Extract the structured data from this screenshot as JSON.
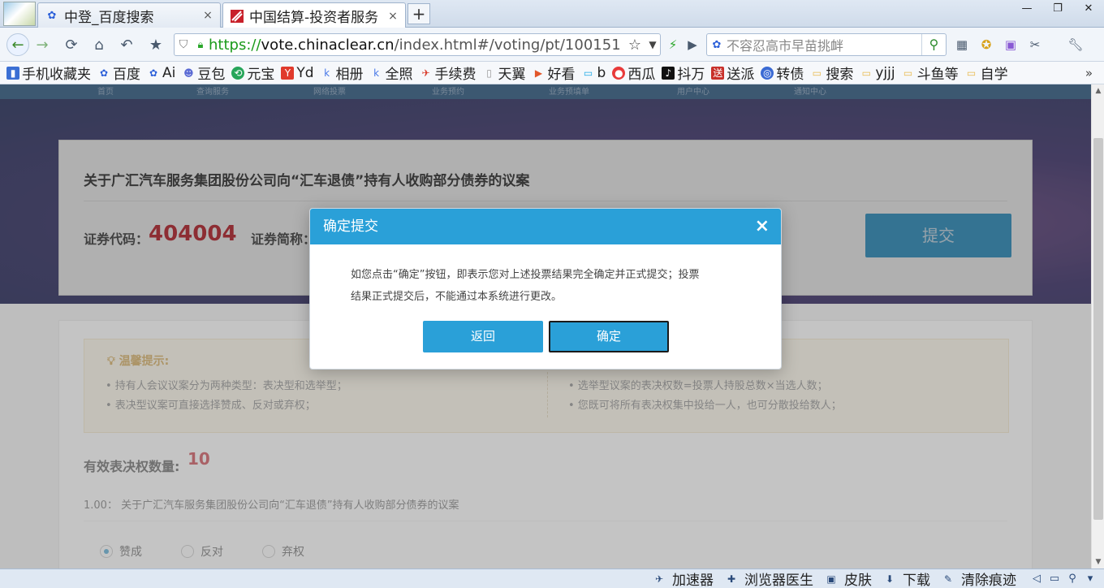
{
  "browser": {
    "tabs": [
      {
        "title": "中登_百度搜索",
        "close": "×"
      },
      {
        "title": "中国结算-投资者服务",
        "close": "×"
      }
    ],
    "new_tab": "+",
    "window": {
      "minimize": "—",
      "restore": "❐",
      "close": "✕"
    },
    "url": {
      "scheme": "https://",
      "host": "vote.chinaclear.cn",
      "path": "/index.html#/voting/pt/100151"
    },
    "search_placeholder": "不容忍高市早苗挑衅",
    "bookmarks": [
      {
        "label": "手机收藏夹",
        "icon": "phone-icon",
        "color": "#3b6fd4"
      },
      {
        "label": "百度",
        "icon": "baidu-paw-icon",
        "color": "#2b5fd9"
      },
      {
        "label": "Ai",
        "icon": "baidu-paw-icon",
        "color": "#2b5fd9"
      },
      {
        "label": "豆包",
        "icon": "doubao-icon",
        "color": "#5a6ad4"
      },
      {
        "label": "元宝",
        "icon": "yuanbao-icon",
        "color": "#27a55a"
      },
      {
        "label": "Yd",
        "icon": "youdao-icon",
        "color": "#e03a2c"
      },
      {
        "label": "相册",
        "icon": "album-icon",
        "color": "#4a7ae8"
      },
      {
        "label": "全照",
        "icon": "album-icon",
        "color": "#4a7ae8"
      },
      {
        "label": "手续费",
        "icon": "plane-icon",
        "color": "#d83a2a"
      },
      {
        "label": "天翼",
        "icon": "page-icon",
        "color": "#999999"
      },
      {
        "label": "好看",
        "icon": "play-icon",
        "color": "#e2572a"
      },
      {
        "label": "b",
        "icon": "bilibili-icon",
        "color": "#1aa7e6"
      },
      {
        "label": "西瓜",
        "icon": "xigua-icon",
        "color": "#e83a3a"
      },
      {
        "label": "抖万",
        "icon": "douyin-icon",
        "color": "#111111"
      },
      {
        "label": "送派",
        "icon": "songpai-icon",
        "color": "#c8302a"
      },
      {
        "label": "转债",
        "icon": "zhuanzhai-icon",
        "color": "#3a6ad4"
      },
      {
        "label": "搜索",
        "icon": "folder-icon",
        "color": "#e8b84a"
      },
      {
        "label": "yjjj",
        "icon": "folder-icon",
        "color": "#e8b84a"
      },
      {
        "label": "斗鱼等",
        "icon": "folder-icon",
        "color": "#e8b84a"
      },
      {
        "label": "自学",
        "icon": "folder-icon",
        "color": "#e8b84a"
      }
    ],
    "bookmarks_more": "»",
    "status_items": [
      {
        "label": "加速器",
        "icon": "rocket-icon"
      },
      {
        "label": "浏览器医生",
        "icon": "doctor-icon"
      },
      {
        "label": "皮肤",
        "icon": "skin-icon"
      },
      {
        "label": "下载",
        "icon": "download-icon"
      },
      {
        "label": "清除痕迹",
        "icon": "broom-icon"
      }
    ]
  },
  "page": {
    "nav_items": [
      "首页",
      "查询服务",
      "网络投票",
      "业务预约",
      "业务预填单",
      "用户中心",
      "通知中心"
    ],
    "proposal_title": "关于广汇汽车服务集团股份公司向“汇车退债”持有人收购部分债券的议案",
    "security_code_label": "证券代码：",
    "security_code": "404004",
    "security_abbr_label": "证券简称：",
    "submit_label": "提交",
    "tips_title": "温馨提示:",
    "tips_left": [
      "• 持有人会议议案分为两种类型：表决型和选举型；",
      "• 表决型议案可直接选择赞成、反对或弃权；"
    ],
    "tips_right": [
      "• 选举型议案的表决权数=投票人持股总数×当选人数；",
      "• 您既可将所有表决权集中投给一人，也可分散投给数人；"
    ],
    "vote_count_label": "有效表决权数量:",
    "vote_count": "10",
    "proposal_line": "1.00：  关于广汇汽车服务集团股份公司向“汇车退债”持有人收购部分债券的议案",
    "options": [
      "赞成",
      "反对",
      "弃权"
    ],
    "selected_option": "赞成"
  },
  "modal": {
    "title": "确定提交",
    "close": "×",
    "message_line1": "如您点击“确定”按钮，即表示您对上述投票结果完全确定并正式提交；投票",
    "message_line2": "结果正式提交后，不能通过本系统进行更改。",
    "back_label": "返回",
    "confirm_label": "确定"
  },
  "colors": {
    "accent": "#2aa0d8",
    "code_red": "#c0121c",
    "submit_blue": "#1e90c8"
  }
}
